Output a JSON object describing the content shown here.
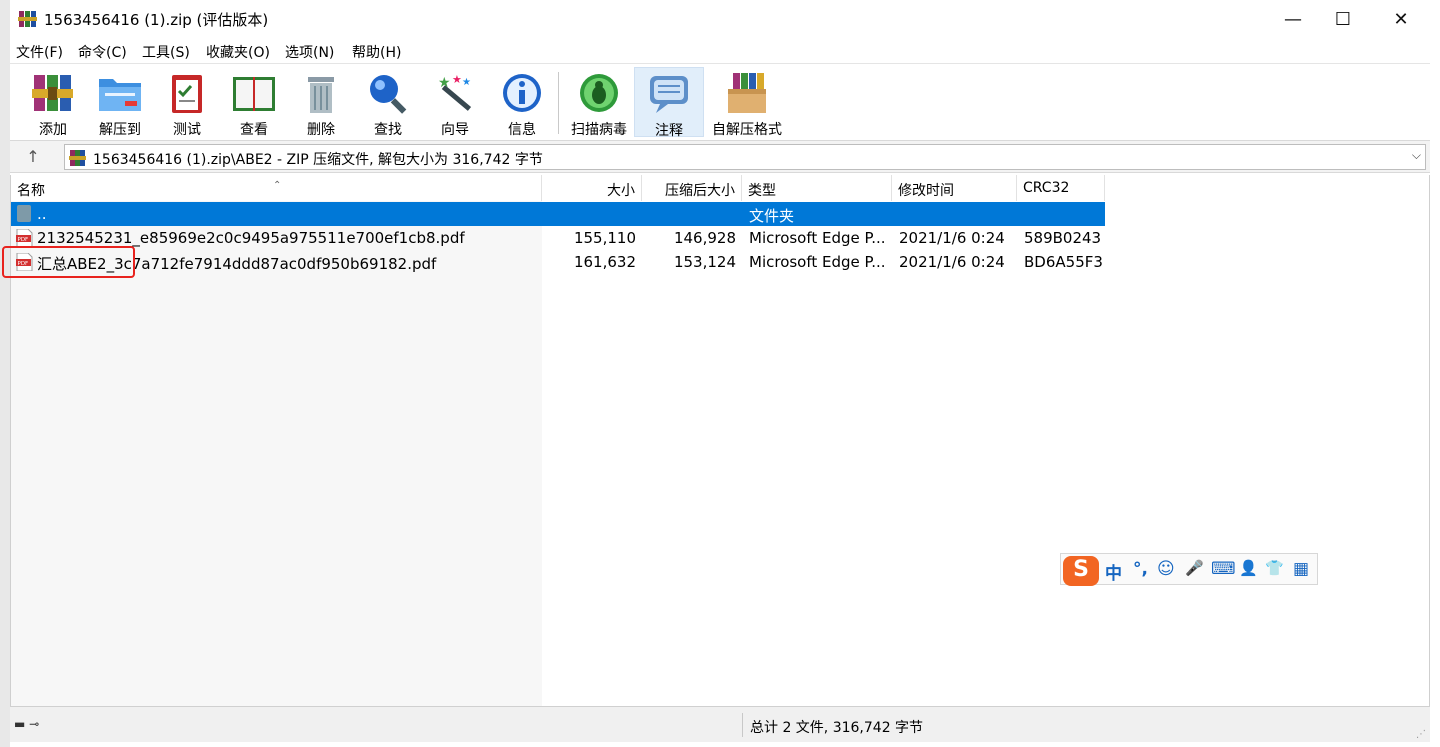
{
  "window": {
    "title": "1563456416 (1).zip (评估版本)",
    "minimize": "—",
    "maximize": "☐",
    "close": "✕"
  },
  "menu": [
    "文件(F)",
    "命令(C)",
    "工具(S)",
    "收藏夹(O)",
    "选项(N)",
    "帮助(H)"
  ],
  "toolbar": {
    "buttons": [
      {
        "label": "添加",
        "icon": "add-archive-icon"
      },
      {
        "label": "解压到",
        "icon": "extract-folder-icon"
      },
      {
        "label": "测试",
        "icon": "test-clipboard-icon"
      },
      {
        "label": "查看",
        "icon": "view-book-icon"
      },
      {
        "label": "删除",
        "icon": "delete-trash-icon"
      },
      {
        "label": "查找",
        "icon": "find-magnifier-icon"
      },
      {
        "label": "向导",
        "icon": "wizard-wand-icon"
      },
      {
        "label": "信息",
        "icon": "info-icon"
      },
      {
        "label": "扫描病毒",
        "icon": "virus-scan-icon"
      },
      {
        "label": "注释",
        "icon": "comment-icon"
      },
      {
        "label": "自解压格式",
        "icon": "sfx-box-icon"
      }
    ]
  },
  "address": {
    "up": "↑",
    "path": "1563456416 (1).zip\\ABE2 - ZIP 压缩文件, 解包大小为 316,742 字节",
    "dropdown": "⌵"
  },
  "columns": {
    "name": "名称",
    "size": "大小",
    "packed": "压缩后大小",
    "type": "类型",
    "modified": "修改时间",
    "crc": "CRC32"
  },
  "rows": [
    {
      "name": "..",
      "size": "",
      "packed": "",
      "type": "文件夹",
      "modified": "",
      "crc": ""
    },
    {
      "name": "2132545231_e85969e2c0c9495a975511e700ef1cb8.pdf",
      "size": "155,110",
      "packed": "146,928",
      "type": "Microsoft Edge P...",
      "modified": "2021/1/6 0:24",
      "crc": "589B0243"
    },
    {
      "name": "汇总ABE2_3c7a712fe7914ddd87ac0df950b69182.pdf",
      "size": "161,632",
      "packed": "153,124",
      "type": "Microsoft Edge P...",
      "modified": "2021/1/6 0:24",
      "crc": "BD6A55F3"
    }
  ],
  "status": {
    "summary": "总计 2 文件, 316,742 字节"
  },
  "ime": {
    "logo": "S",
    "mode": "中",
    "punct": "°,",
    "emoji": "☺",
    "voice": "🎤",
    "keyboard": "⌨",
    "user": "👤",
    "skin": "👕",
    "tools": "▦"
  },
  "colors": {
    "selection": "#0078d7",
    "highlight": "#e8231e",
    "accent_blue": "#1565c0"
  }
}
